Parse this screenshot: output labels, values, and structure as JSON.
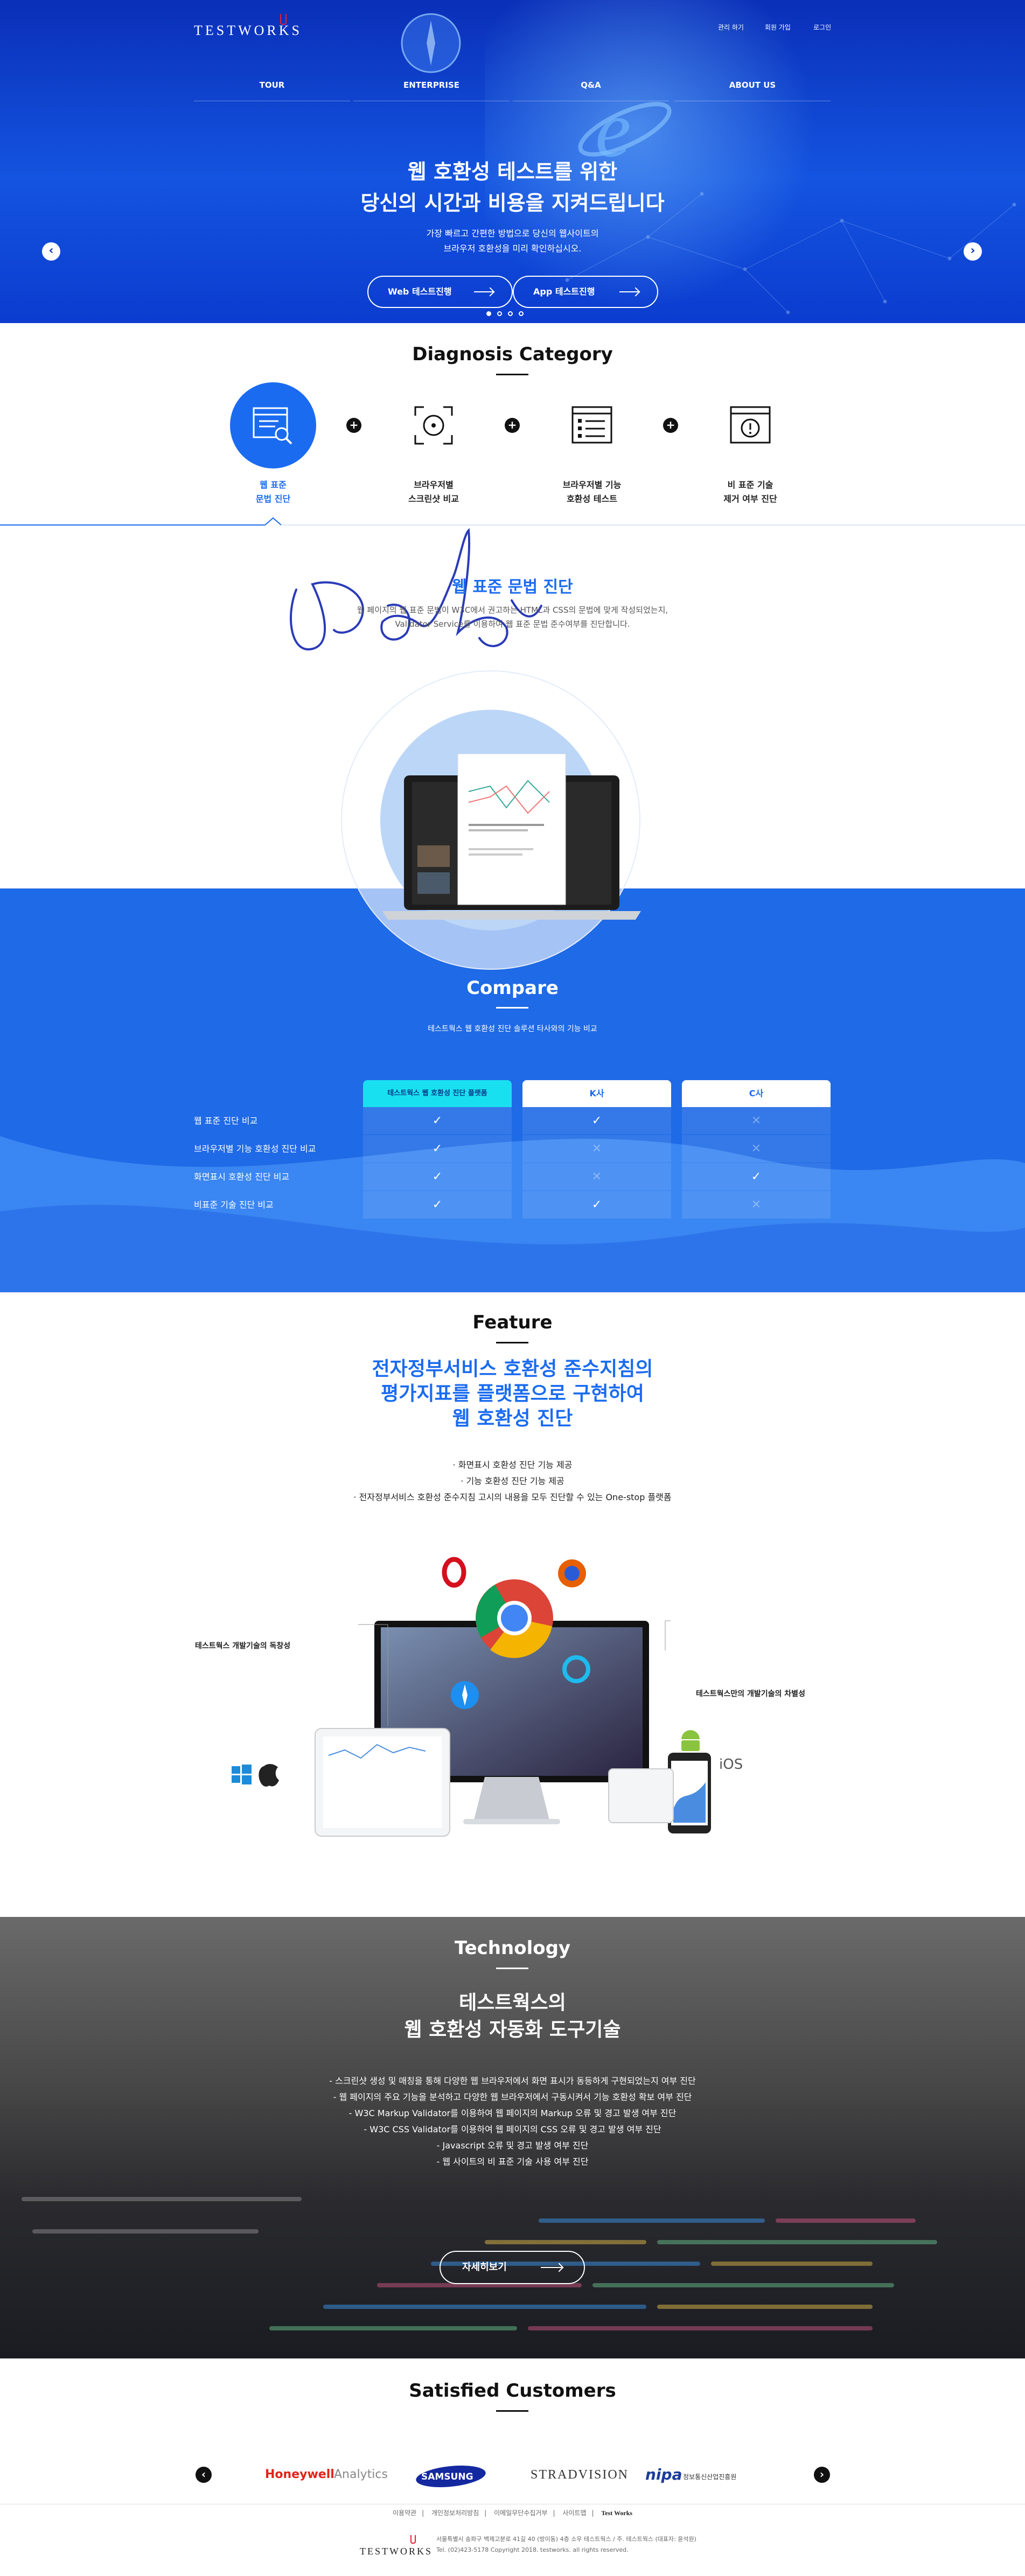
{
  "header": {
    "logo": "TESTWORKS",
    "util_links": [
      "관리 하기",
      "회원 가입",
      "로그인"
    ],
    "nav": [
      "TOUR",
      "ENTERPRISE",
      "Q&A",
      "ABOUT US"
    ]
  },
  "hero": {
    "title_line1": "웹 호환성 테스트를 위한",
    "title_line2": "당신의 시간과 비용을 지켜드립니다",
    "sub_line1": "가장 빠르고 간편한 방법으로 당신의 웹사이트의",
    "sub_line2": "브라우저 호환성을 미리 확인하십시오.",
    "buttons": [
      "Web 테스트진행",
      "App 테스트진행"
    ],
    "prev": "‹",
    "next": "›",
    "active_slide": 1,
    "slide_count": 4
  },
  "diagnosis": {
    "title": "Diagnosis Category",
    "categories": [
      {
        "line1": "웹 표준",
        "line2": "문법 진단",
        "icon": "browser-search-icon",
        "active": true
      },
      {
        "line1": "브라우저별",
        "line2": "스크린샷 비교",
        "icon": "screenshot-focus-icon",
        "active": false
      },
      {
        "line1": "브라우저별 기능",
        "line2": "호환성 테스트",
        "icon": "browser-list-icon",
        "active": false
      },
      {
        "line1": "비 표준 기술",
        "line2": "제거 여부 진단",
        "icon": "browser-alert-icon",
        "active": false
      }
    ],
    "plus": "+",
    "detail_title": "웹 표준 문법 진단",
    "detail_line1": "웹 페이지의 웹 표준 문법이 W3C에서 권고하는 HTML과 CSS의 문법에 맞게 작성되었는지,",
    "detail_line2": "Validator Service를 이용하여 웹 표준 문법 준수여부를 진단합니다."
  },
  "compare": {
    "title": "Compare",
    "subtitle": "테스트웍스 웹 호환성 진단 솔루션 타사와의 기능 비교",
    "columns": [
      "테스트웍스 웹 호환성 진단 플랫폼",
      "K사",
      "C사"
    ],
    "rows": [
      {
        "label": "웹 표준 진단 비교",
        "values": [
          true,
          true,
          false
        ]
      },
      {
        "label": "브라우저별 기능 호환성 진단 비교",
        "values": [
          true,
          false,
          false
        ]
      },
      {
        "label": "화면표시 호환성 진단 비교",
        "values": [
          true,
          false,
          true
        ]
      },
      {
        "label": "비표준 기술 진단 비교",
        "values": [
          true,
          true,
          false
        ]
      }
    ],
    "check": "✓",
    "cross": "✕"
  },
  "feature": {
    "title": "Feature",
    "heading_line1": "전자정부서비스 호환성 준수지침의",
    "heading_line2": "평가지표를 플랫폼으로 구현하여",
    "heading_line3": "웹 호환성 진단",
    "list": [
      "· 화면표시 호환성 진단 기능 제공",
      "· 기능 호환성 진단 기능 제공",
      "· 전자정부서비스 호환성 준수지침 고시의 내용을 모두 진단할 수 있는 One-stop 플랫폼"
    ],
    "left_callout": "테스트웍스 개발기술의 독창성",
    "right_callout": "테스트웍스만의 개발기술의 차별성",
    "ios_label": "iOS"
  },
  "technology": {
    "title": "Technology",
    "heading_line1": "테스트웍스의",
    "heading_line2": "웹 호환성 자동화 도구기술",
    "list": [
      "- 스크린샷 생성 및 매칭을 통해 다양한 웹 브라우저에서 화면 표시가 동등하게 구현되었는지 여부 진단",
      "- 웹 페이지의 주요 기능을 분석하고 다양한 웹 브라우저에서 구동시켜서 기능 호환성 확보 여부 진단",
      "- W3C Markup Validator를 이용하여 웹 페이지의 Markup 오류 및 경고 발생 여부 진단",
      "- W3C CSS Validator를 이용하여 웹 페이지의 CSS 오류 및 경고 발생 여부 진단",
      "- Javascript 오류 및 경고 발생 여부 진단",
      "- 웹 사이트의 비 표준 기술 사용 여부 진단"
    ],
    "button": "자세히보기"
  },
  "customers": {
    "title": "Satisfied Customers",
    "logos": [
      "Honeywell",
      "Analytics",
      "SAMSUNG",
      "STRADVISION",
      "nipa",
      "정보통신산업진흥원"
    ],
    "prev": "‹",
    "next": "›"
  },
  "footer": {
    "links": [
      "이용약관",
      "개인정보처리방침",
      "이메일무단수집거부",
      "사이트맵",
      "Test Works"
    ],
    "address": "서울특별시 송파구 백제고분로 41길 40 (방이동) 4층 소우 테스트웍스 / 주. 테스트웍스 (대표자: 윤석원)",
    "contact": "Tel. (02)423-5178        Copyright 2018. testworks. all rights reserved.",
    "logo": "TESTWORKS"
  },
  "colors": {
    "brand_blue": "#1a6bf0",
    "hero_blue": "#0a2fb8",
    "compare_bg": "#1f6ae6",
    "highlight_cyan": "#19e0f0"
  }
}
